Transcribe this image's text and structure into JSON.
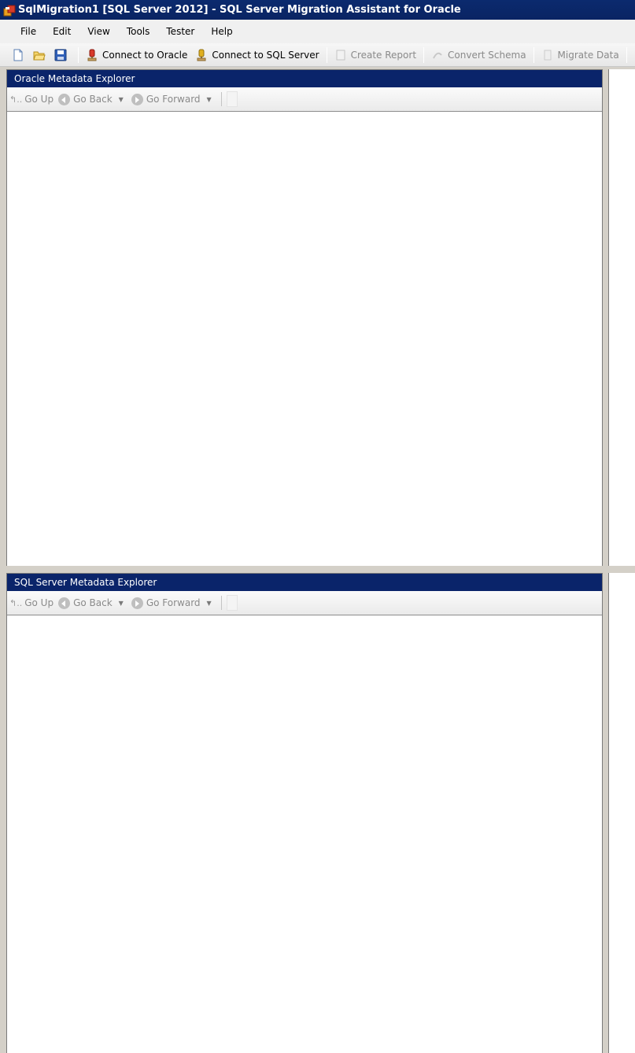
{
  "window": {
    "title": "SqlMigration1 [SQL Server 2012] - SQL Server Migration Assistant for Oracle"
  },
  "menu": {
    "items": [
      "File",
      "Edit",
      "View",
      "Tools",
      "Tester",
      "Help"
    ]
  },
  "toolbar": {
    "connect_oracle": "Connect to Oracle",
    "connect_sql": "Connect to SQL Server",
    "create_report": "Create Report",
    "convert_schema": "Convert Schema",
    "migrate_data": "Migrate Data"
  },
  "oracle_explorer": {
    "title": "Oracle Metadata Explorer",
    "go_up": "Go Up",
    "go_back": "Go Back",
    "go_forward": "Go Forward"
  },
  "sql_explorer": {
    "title": "SQL Server Metadata Explorer",
    "go_up": "Go Up",
    "go_back": "Go Back",
    "go_forward": "Go Forward"
  },
  "colors": {
    "title_bar": "#0a2463",
    "panel_header": "#0a246a",
    "disabled_text": "#8a8a8a"
  },
  "icons": [
    "app-icon",
    "new-project-icon",
    "open-folder-icon",
    "save-icon",
    "oracle-connect-icon",
    "sql-connect-icon",
    "report-icon",
    "convert-icon",
    "migrate-icon",
    "stop-icon",
    "up-arrow-icon",
    "back-arrow-icon",
    "forward-arrow-icon"
  ]
}
